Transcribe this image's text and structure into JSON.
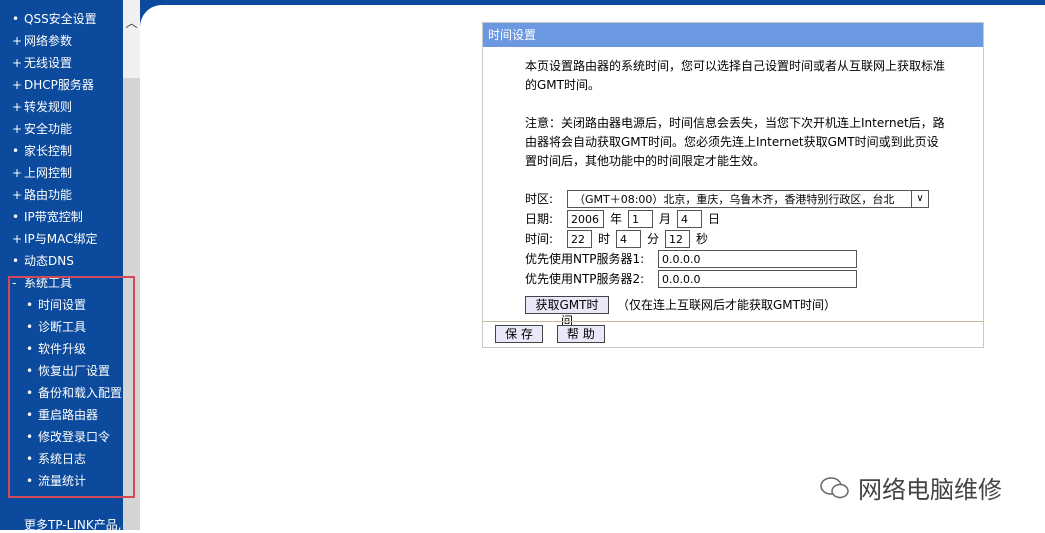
{
  "sidebar": {
    "items": [
      {
        "bullet": "•",
        "label": "QSS安全设置"
      },
      {
        "bullet": "+",
        "label": "网络参数"
      },
      {
        "bullet": "+",
        "label": "无线设置"
      },
      {
        "bullet": "+",
        "label": "DHCP服务器"
      },
      {
        "bullet": "+",
        "label": "转发规则"
      },
      {
        "bullet": "+",
        "label": "安全功能"
      },
      {
        "bullet": "•",
        "label": "家长控制"
      },
      {
        "bullet": "+",
        "label": "上网控制"
      },
      {
        "bullet": "+",
        "label": "路由功能"
      },
      {
        "bullet": "•",
        "label": "IP带宽控制"
      },
      {
        "bullet": "+",
        "label": "IP与MAC绑定"
      },
      {
        "bullet": "•",
        "label": "动态DNS"
      },
      {
        "bullet": "-",
        "label": "系统工具"
      }
    ],
    "subitems": [
      "时间设置",
      "诊断工具",
      "软件升级",
      "恢复出厂设置",
      "备份和载入配置",
      "重启路由器",
      "修改登录口令",
      "系统日志",
      "流量统计"
    ],
    "more": "更多TP-LINK产品,"
  },
  "panel": {
    "title": "时间设置",
    "intro": "本页设置路由器的系统时间，您可以选择自己设置时间或者从互联网上获取标准的GMT时间。",
    "note": "注意：关闭路由器电源后，时间信息会丢失，当您下次开机连上Internet后，路由器将会自动获取GMT时间。您必须先连上Internet获取GMT时间或到此页设置时间后，其他功能中的时间限定才能生效。",
    "timezone_label": "时区:",
    "timezone_value": "（GMT＋08:00）北京，重庆，乌鲁木齐，香港特别行政区，台北",
    "date_label": "日期:",
    "year": "2006",
    "year_unit": "年",
    "month": "1",
    "month_unit": "月",
    "day": "4",
    "day_unit": "日",
    "time_label": "时间:",
    "hour": "22",
    "hour_unit": "时",
    "minute": "4",
    "minute_unit": "分",
    "second": "12",
    "second_unit": "秒",
    "ntp1_label": "优先使用NTP服务器1:",
    "ntp1": "0.0.0.0",
    "ntp2_label": "优先使用NTP服务器2:",
    "ntp2": "0.0.0.0",
    "get_gmt": "获取GMT时间",
    "get_gmt_hint": "（仅在连上互联网后才能获取GMT时间）",
    "save": "保 存",
    "help": "帮 助"
  },
  "watermark": "网络电脑维修"
}
